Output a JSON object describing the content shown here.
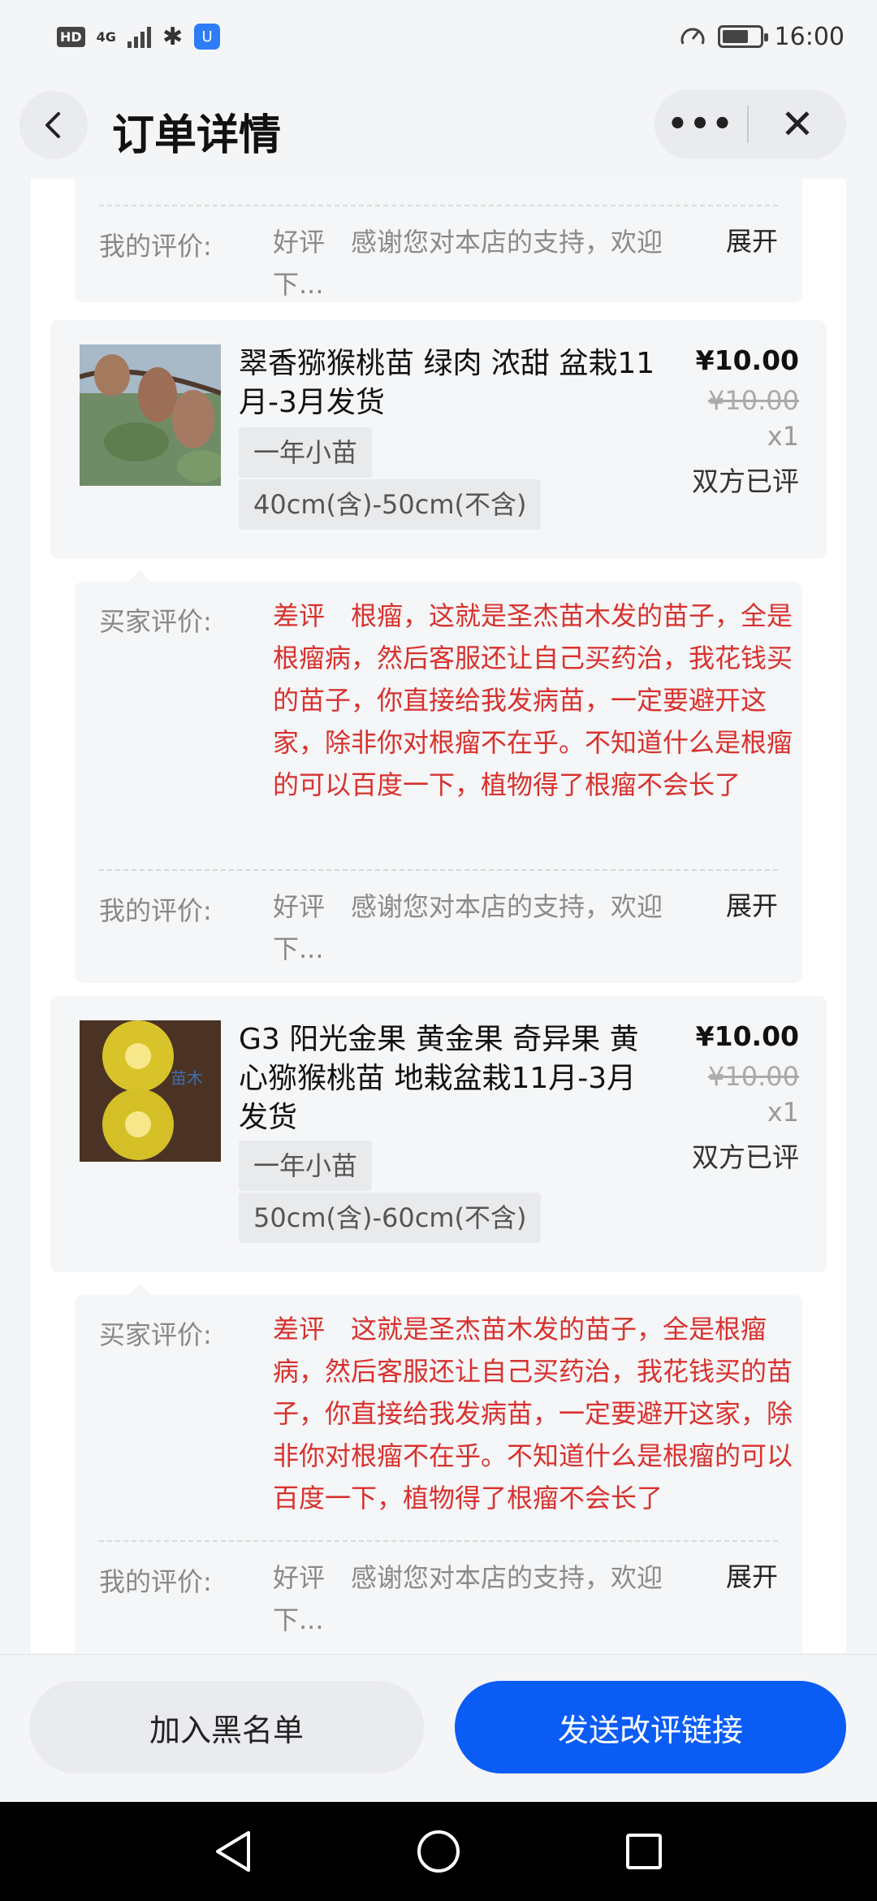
{
  "status_bar": {
    "left_badge": "HD",
    "network": "4G",
    "bluetooth": "✱",
    "app_icon": "U",
    "time": "16:00",
    "battery_level": 0.7
  },
  "header": {
    "back_icon": "back-arrow-icon",
    "title": "订单详情",
    "more_icon": "•••",
    "close_icon": "✕"
  },
  "top_review": {
    "my_label": "我的评价:",
    "my_text": "好评　感谢您对本店的支持，欢迎下...",
    "expand": "展开"
  },
  "items": [
    {
      "thumb": "kiwi-fruit-on-vine",
      "title": "翠香猕猴桃苗 绿肉 浓甜 盆栽11月-3月发货",
      "sku1": "一年小苗",
      "sku2": "40cm(含)-50cm(不含)",
      "price": "¥10.00",
      "old_price": "¥10.00",
      "qty": "x1",
      "status": "双方已评",
      "buyer_label": "买家评价:",
      "buyer_text": "差评　根瘤，这就是圣杰苗木发的苗子，全是根瘤病，然后客服还让自己买药治，我花钱买的苗子，你直接给我发病苗，一定要避开这家，除非你对根瘤不在乎。不知道什么是根瘤的可以百度一下，植物得了根瘤不会长了",
      "my_label": "我的评价:",
      "my_text": "好评　感谢您对本店的支持，欢迎下...",
      "expand": "展开"
    },
    {
      "thumb": "golden-kiwi-halves",
      "thumb_watermark": "苗木",
      "title": "G3 阳光金果 黄金果 奇异果 黄心猕猴桃苗 地栽盆栽11月-3月发货",
      "sku1": "一年小苗",
      "sku2": "50cm(含)-60cm(不含)",
      "price": "¥10.00",
      "old_price": "¥10.00",
      "qty": "x1",
      "status": "双方已评",
      "buyer_label": "买家评价:",
      "buyer_text": "差评　这就是圣杰苗木发的苗子，全是根瘤病，然后客服还让自己买药治，我花钱买的苗子，你直接给我发病苗，一定要避开这家，除非你对根瘤不在乎。不知道什么是根瘤的可以百度一下，植物得了根瘤不会长了",
      "my_label": "我的评价:",
      "my_text": "好评　感谢您对本店的支持，欢迎下...",
      "expand": "展开"
    }
  ],
  "footer": {
    "blacklist_label": "加入黑名单",
    "send_label": "发送改评链接"
  },
  "colors": {
    "accent": "#0a5cf5",
    "negative_review": "#d8312e"
  }
}
